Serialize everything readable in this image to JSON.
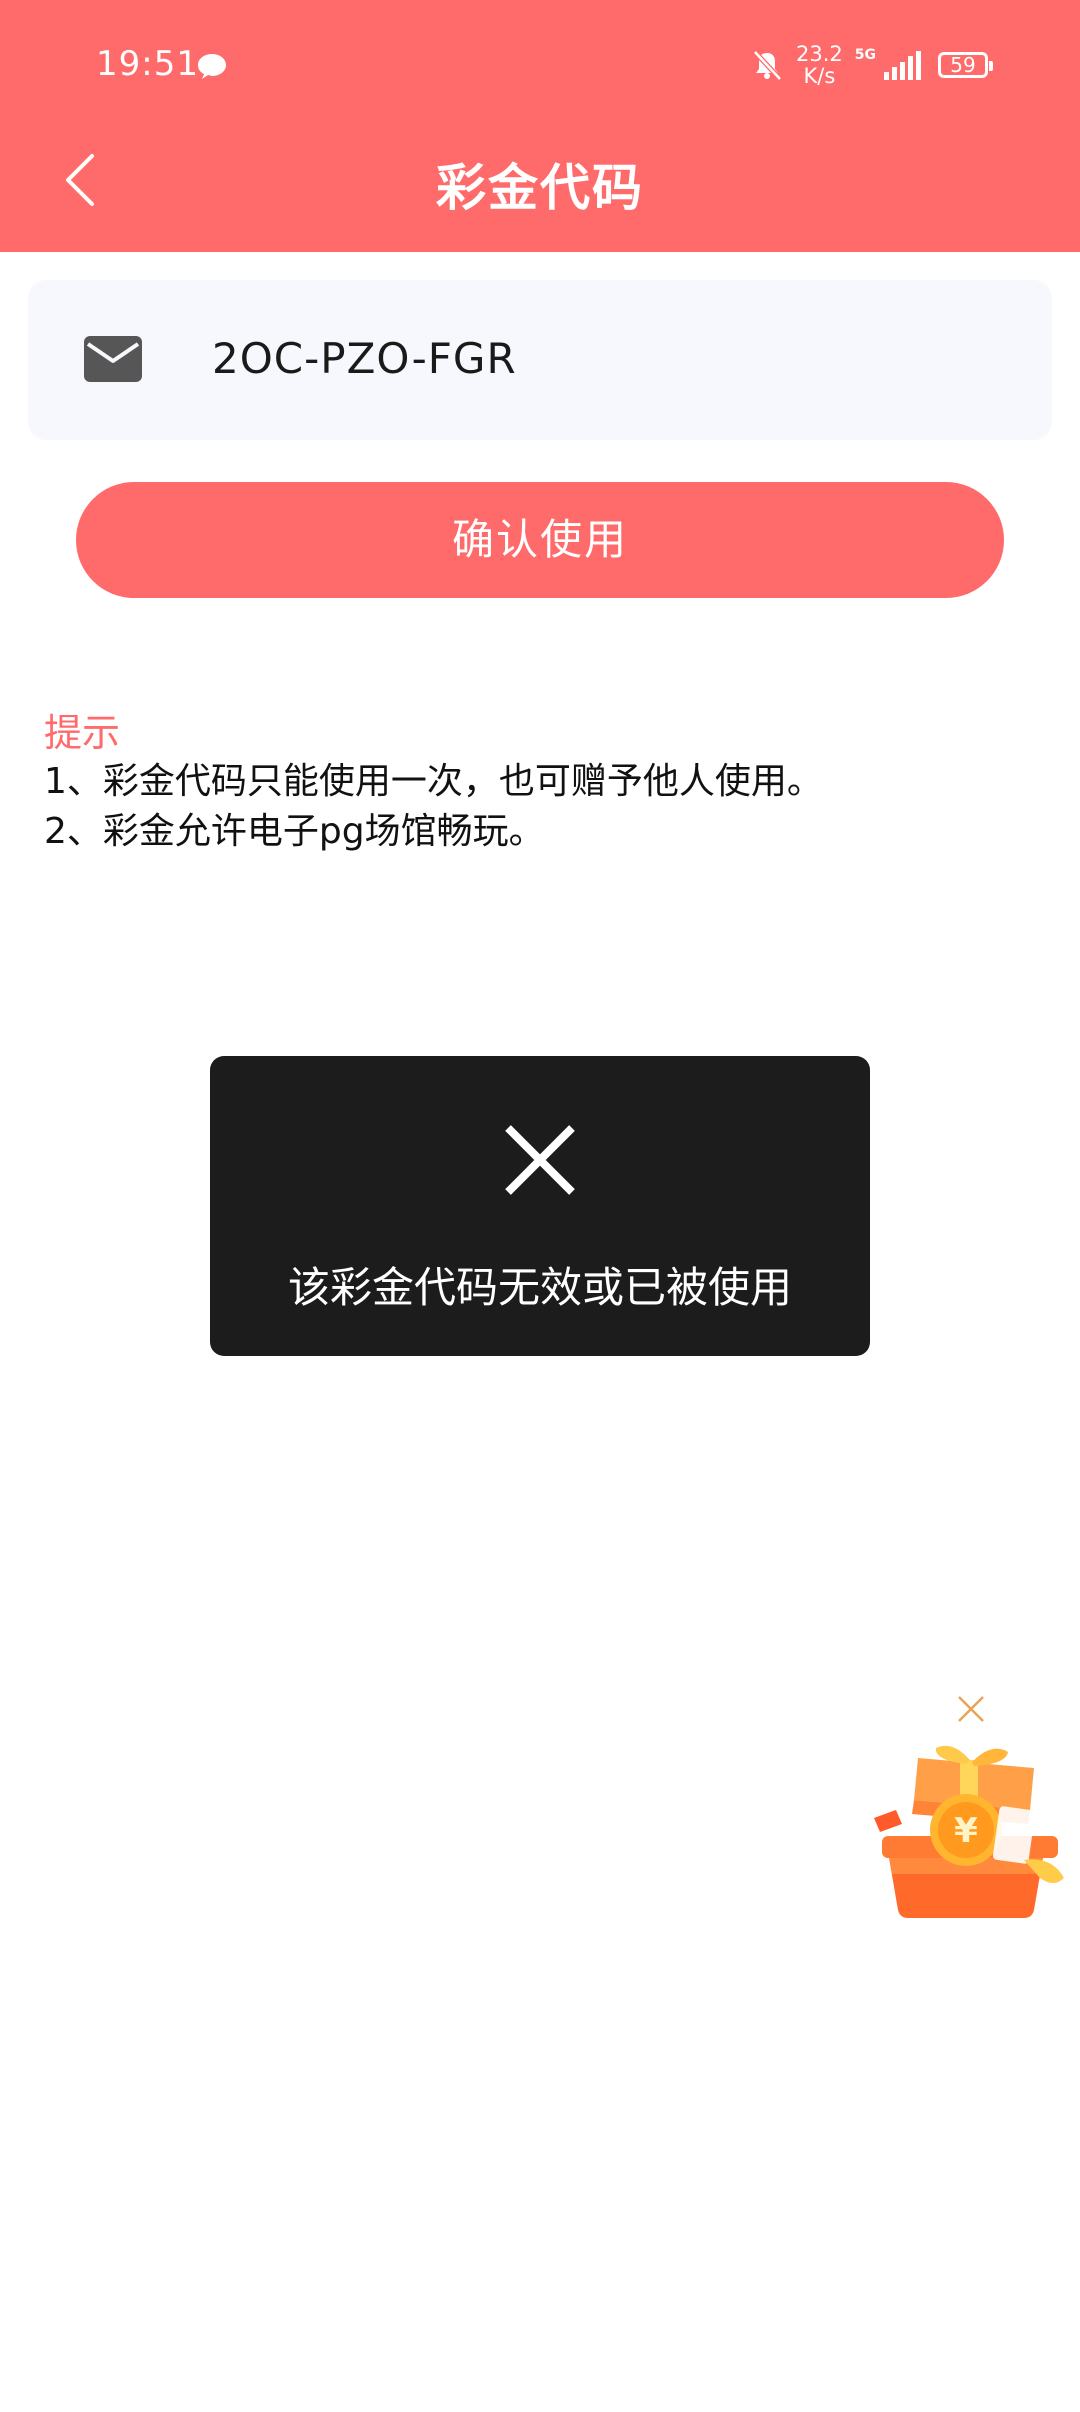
{
  "status_bar": {
    "time": "19:51",
    "net_speed_value": "23.2",
    "net_speed_unit": "K/s",
    "network_type": "5G",
    "battery": "59"
  },
  "header": {
    "title": "彩金代码"
  },
  "code_input": {
    "value": "2OC-PZO-FGR"
  },
  "confirm_button": {
    "label": "确认使用"
  },
  "tips": {
    "title": "提示",
    "items": [
      "1、彩金代码只能使用一次，也可赠予他人使用。",
      "2、彩金允许电子pg场馆畅玩。"
    ]
  },
  "toast": {
    "message": "该彩金代码无效或已被使用"
  },
  "icons": {
    "back": "back-arrow-icon",
    "mail": "mail-icon",
    "toast": "close-icon",
    "gift": "gift-box-icon"
  },
  "colors": {
    "brand": "#ff6b6b",
    "toast_bg": "#1c1c1c",
    "input_bg": "#f7f8fd"
  }
}
